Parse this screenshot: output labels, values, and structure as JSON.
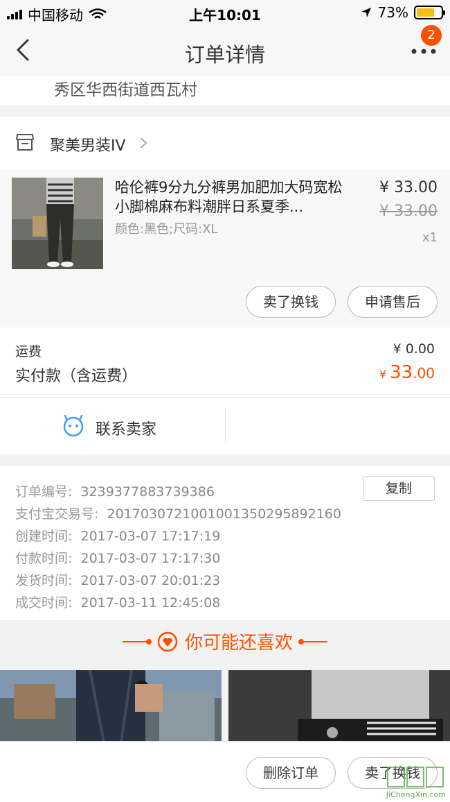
{
  "status_bar": {
    "carrier": "中国移动",
    "time": "上午10:01",
    "battery": "73%",
    "battery_level": 0.73
  },
  "nav": {
    "title": "订单详情",
    "badge": "2"
  },
  "address": {
    "tail": "秀区华西街道西瓦村"
  },
  "shop": {
    "name": "聚美男装IV"
  },
  "product": {
    "title": "哈伦裤9分九分裤男加肥加大码宽松小脚棉麻布料潮胖日系夏季...",
    "sku": "颜色:黑色;尺码:XL",
    "price": "¥ 33.00",
    "original_price": "¥ 33.00",
    "quantity": "x1",
    "sell_button": "卖了换钱",
    "after_sale_button": "申请售后"
  },
  "fees": {
    "shipping_label": "运费",
    "shipping_value": "¥ 0.00",
    "paid_label": "实付款（含运费）",
    "paid_currency": "¥ ",
    "paid_int": "33",
    "paid_dec": ".00"
  },
  "contact": {
    "label": "联系卖家"
  },
  "order_info": {
    "copy_button": "复制",
    "rows": [
      {
        "key": "订单编号:",
        "value": "3239377883739386"
      },
      {
        "key": "支付宝交易号:",
        "value": "2017030721001001350295892160"
      },
      {
        "key": "创建时间:",
        "value": "2017-03-07 17:17:19"
      },
      {
        "key": "付款时间:",
        "value": "2017-03-07 17:17:30"
      },
      {
        "key": "发货时间:",
        "value": "2017-03-07 20:01:23"
      },
      {
        "key": "成交时间:",
        "value": "2017-03-11 12:45:08"
      }
    ]
  },
  "recommend": {
    "title": "你可能还喜欢"
  },
  "bottom_bar": {
    "delete_button": "删除订单",
    "sell_button": "卖了换钱"
  },
  "watermark": {
    "text": "JiChengXin.com"
  },
  "colors": {
    "accent": "#ff5000",
    "battery": "#f4c017",
    "contact_icon": "#3aa0f5"
  }
}
